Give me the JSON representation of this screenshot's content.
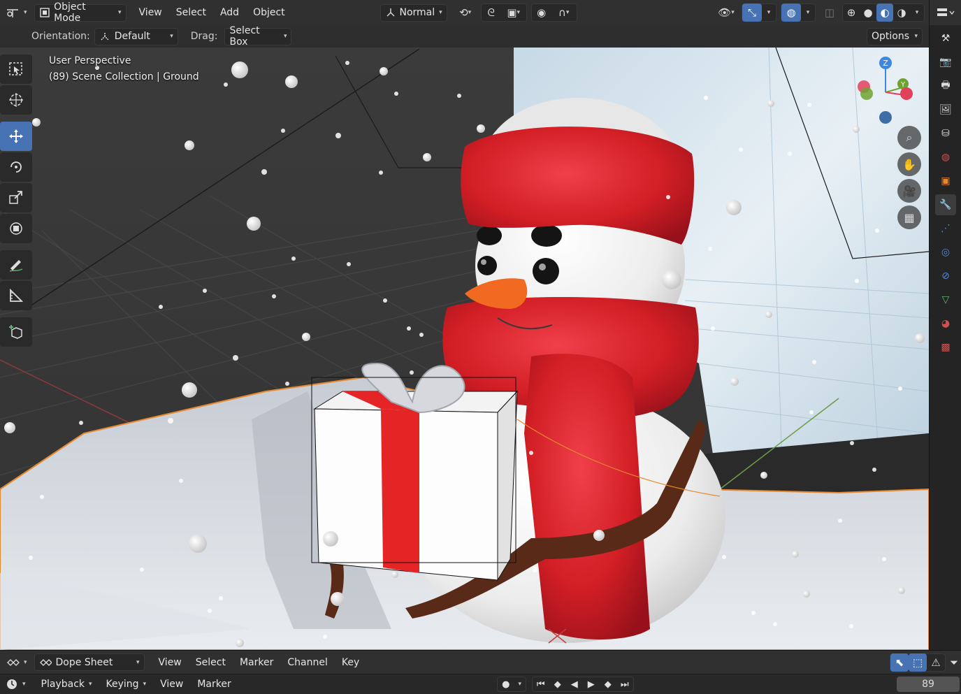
{
  "header": {
    "editor_icon": "viewport-editor-icon",
    "mode": "Object Mode",
    "menus": [
      "View",
      "Select",
      "Add",
      "Object"
    ],
    "transform_orientation": "Normal",
    "options_label": "Options"
  },
  "tool_header": {
    "orientation_label": "Orientation:",
    "orientation_value": "Default",
    "drag_label": "Drag:",
    "drag_value": "Select Box"
  },
  "viewport": {
    "view_name": "User Perspective",
    "collection_info": "(89) Scene Collection | Ground",
    "gizmo": {
      "z": "Z",
      "y": "Y",
      "x_color": "#e2415c",
      "y_color": "#6fa331",
      "z_color": "#3d87e0"
    }
  },
  "toolbar": {
    "tools": [
      "select-box",
      "cursor",
      "move",
      "rotate",
      "scale",
      "transform",
      "annotate",
      "measure",
      "add-cube"
    ],
    "active": "move"
  },
  "properties_tabs": [
    "tool",
    "render",
    "output",
    "view-layer",
    "scene",
    "world",
    "object",
    "modifiers",
    "particles",
    "physics",
    "constraints",
    "data",
    "material",
    "texture"
  ],
  "dope_sheet": {
    "editor_type": "Dope Sheet",
    "menus": [
      "View",
      "Select",
      "Marker",
      "Channel",
      "Key"
    ],
    "playback_label": "Playback",
    "keying_label": "Keying",
    "timeline_menus": [
      "View",
      "Marker"
    ],
    "current_frame": "89"
  },
  "colors": {
    "accent": "#4772b3",
    "header_bg": "#303030",
    "selection_outline": "#e8882c"
  }
}
